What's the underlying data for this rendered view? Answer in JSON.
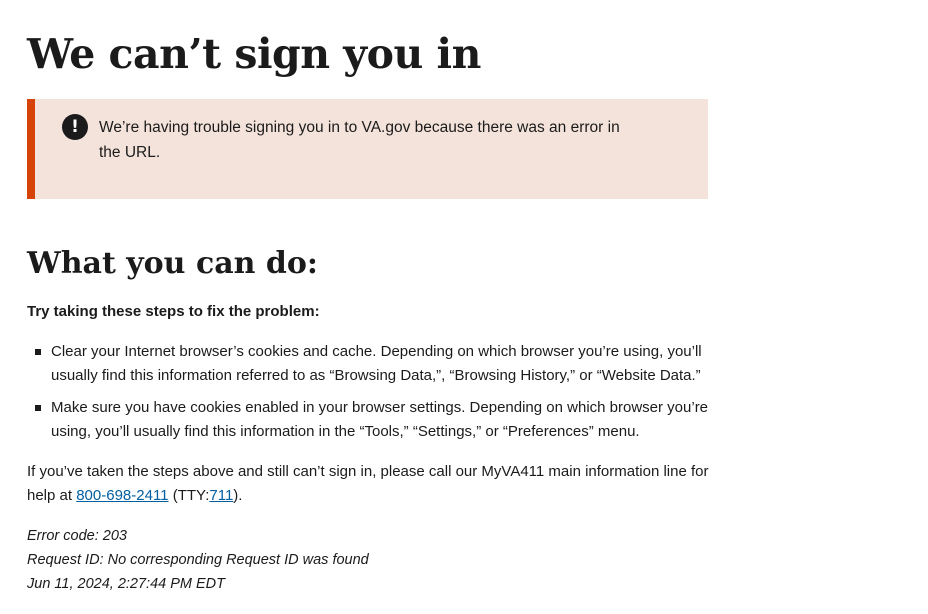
{
  "page": {
    "title": "We can’t sign you in"
  },
  "alert": {
    "icon": "exclamation-circle-icon",
    "icon_glyph": "!",
    "message": "We’re having trouble signing you in to VA.gov because there was an error in the URL.",
    "accent_color": "#d54309",
    "background_color": "#f4e3db"
  },
  "what_to_do": {
    "heading": "What you can do:",
    "intro": "Try taking these steps to fix the problem:",
    "steps": [
      "Clear your Internet browser’s cookies and cache. Depending on which browser you’re using, you’ll usually find this information referred to as “Browsing Data,”, “Browsing History,” or “Website Data.”",
      "Make sure you have cookies enabled in your browser settings. Depending on which browser you’re using, you’ll usually find this information in the “Tools,” “Settings,” or “Preferences” menu."
    ]
  },
  "help": {
    "text_before": "If you’ve taken the steps above and still can’t sign in, please call our MyVA411 main information line for help at ",
    "phone_link": "800-698-2411",
    "text_middle": " (TTY:",
    "tty_link": "711",
    "text_after": ").",
    "link_color": "#005ea2"
  },
  "error_details": {
    "error_code": "Error code: 203",
    "request_id": "Request ID: No corresponding Request ID was found",
    "timestamp": "Jun 11, 2024, 2:27:44 PM EDT"
  }
}
